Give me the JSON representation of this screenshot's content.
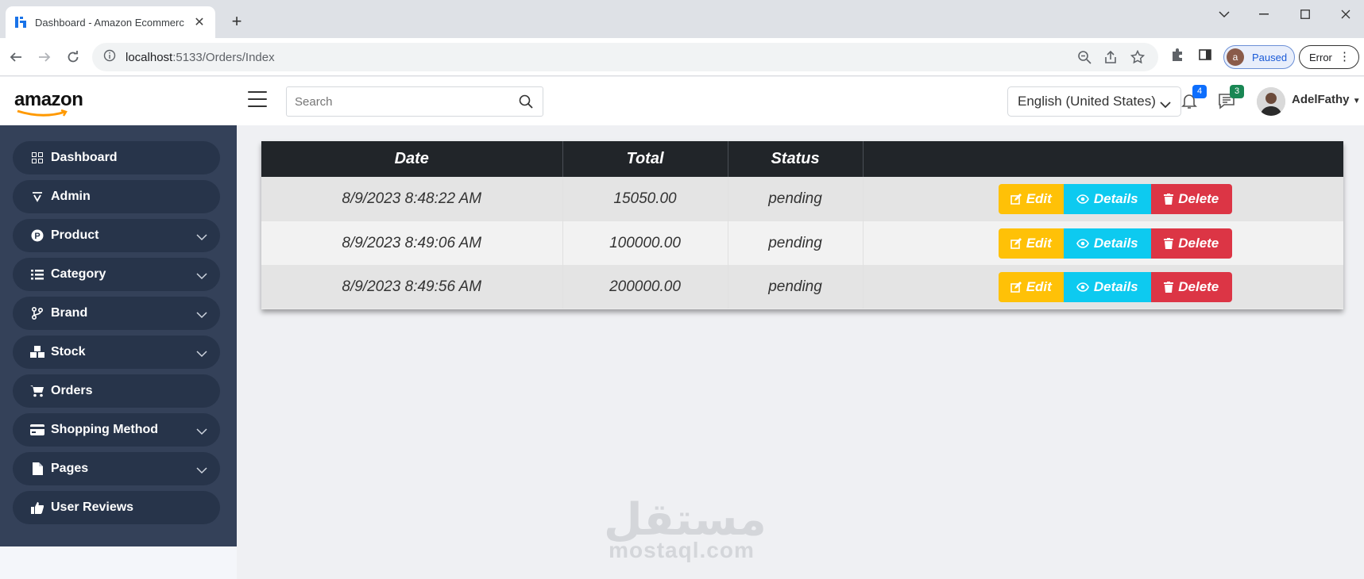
{
  "browser": {
    "tab_title": "Dashboard - Amazon Ecommerc",
    "url_host": "localhost",
    "url_path": ":5133/Orders/Index",
    "profile_initial": "a",
    "profile_status": "Paused",
    "error_label": "Error"
  },
  "header": {
    "logo_text": "amazon",
    "search_placeholder": "Search",
    "language": "English (United States)",
    "notifications_count": "4",
    "messages_count": "3",
    "username": "AdelFathy"
  },
  "sidebar": {
    "items": [
      {
        "label": "Dashboard",
        "icon": "grid-icon",
        "has_caret": false
      },
      {
        "label": "Admin",
        "icon": "admin-icon",
        "has_caret": false
      },
      {
        "label": "Product",
        "icon": "product-icon",
        "has_caret": true
      },
      {
        "label": "Category",
        "icon": "list-icon",
        "has_caret": true
      },
      {
        "label": "Brand",
        "icon": "branch-icon",
        "has_caret": true
      },
      {
        "label": "Stock",
        "icon": "boxes-icon",
        "has_caret": true
      },
      {
        "label": "Orders",
        "icon": "cart-icon",
        "has_caret": false
      },
      {
        "label": "Shopping Method",
        "icon": "credit-card-icon",
        "has_caret": true
      },
      {
        "label": "Pages",
        "icon": "file-icon",
        "has_caret": true
      },
      {
        "label": "User Reviews",
        "icon": "thumbs-up-icon",
        "has_caret": false
      }
    ]
  },
  "orders": {
    "columns": [
      "Date",
      "Total",
      "Status",
      ""
    ],
    "rows": [
      {
        "date": "8/9/2023 8:48:22 AM",
        "total": "15050.00",
        "status": "pending"
      },
      {
        "date": "8/9/2023 8:49:06 AM",
        "total": "100000.00",
        "status": "pending"
      },
      {
        "date": "8/9/2023 8:49:56 AM",
        "total": "200000.00",
        "status": "pending"
      }
    ],
    "actions": {
      "edit": "Edit",
      "details": "Details",
      "delete": "Delete"
    }
  },
  "watermark": {
    "arabic": "مستقل",
    "latin": "mostaql.com"
  },
  "colors": {
    "sidebar_bg": "#344159",
    "sidebar_item_bg": "#27344a",
    "table_header_bg": "#212529",
    "edit": "#ffc107",
    "details": "#0dcaf0",
    "delete": "#dc3545",
    "notif_badge": "#0d6efd",
    "msg_badge": "#198754"
  }
}
